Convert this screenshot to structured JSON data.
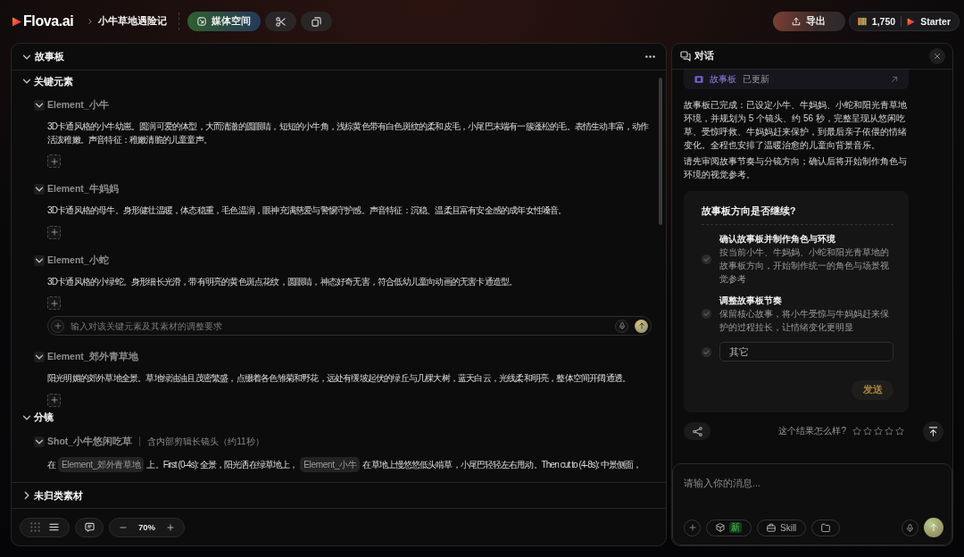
{
  "header": {
    "logo": "Flova.ai",
    "project_title": "小牛草地遇险记",
    "tools": [
      {
        "kind": "media",
        "label": "媒体空间"
      },
      {
        "kind": "scissors"
      },
      {
        "kind": "copy"
      }
    ],
    "export_label": "导出",
    "credits": "1,750",
    "plan": "Starter"
  },
  "storyboard": {
    "title": "故事板",
    "expanded": true,
    "sections": [
      {
        "kind": "elements",
        "title": "关键元素",
        "expanded": true,
        "items": [
          {
            "name": "Element_小牛",
            "expanded": true,
            "description": "3D卡通风格的小牛幼崽。圆润可爱的体型，大而清澈的圆眼睛，短短的小牛角，浅棕黄色带有白色斑纹的柔和皮毛，小尾巴末端有一簇蓬松的毛。表情生动丰富，动作活泼稚嫩。声音特征：稚嫩清脆的儿童童声。"
          },
          {
            "name": "Element_牛妈妈",
            "expanded": true,
            "description": "3D卡通风格的母牛。身形健壮温暖，体态稳重，毛色温润，眼神充满慈爱与警惕守护感。声音特征：沉稳、温柔且富有安全感的成年女性嗓音。"
          },
          {
            "name": "Element_小蛇",
            "expanded": true,
            "description": "3D卡通风格的小绿蛇。身形细长光滑，带有明亮的黄色斑点花纹，圆眼睛，神态好奇无害，符合低幼儿童向动画的无害卡通造型。",
            "input_placeholder": "输入对该关键元素及其素材的调整要求"
          },
          {
            "name": "Element_郊外青草地",
            "expanded": true,
            "description": "阳光明媚的郊外草地全景。草地绿油油且茂密繁盛，点缀着各色雏菊和野花，远处有缓坡起伏的绿丘与几棵大树，蓝天白云，光线柔和明亮，整体空间开阔通透。"
          }
        ]
      },
      {
        "kind": "shots",
        "title": "分镜",
        "expanded": true,
        "items": [
          {
            "name": "Shot_小牛悠闲吃草",
            "note": "含内部剪辑长镜头（约11秒）",
            "expanded": true,
            "script": [
              {
                "kind": "text",
                "text": "在"
              },
              {
                "kind": "tag",
                "text": "Element_郊外青草地"
              },
              {
                "kind": "text",
                "text": "上。First (0-4s): 全景，阳光洒在绿草地上，"
              },
              {
                "kind": "tag",
                "text": "Element_小牛"
              },
              {
                "kind": "text",
                "text": "在草地上慢悠悠低头啃草，小尾巴轻轻左右甩动。Then cut to (4-8s): 中景侧面，"
              }
            ]
          }
        ]
      }
    ],
    "pinned_section": {
      "title": "未归类素材",
      "expanded": false
    },
    "toolbar": {
      "view_modes": [
        {
          "kind": "grid",
          "selected": false
        },
        {
          "kind": "list",
          "selected": true
        }
      ],
      "zoom": "70%"
    }
  },
  "chat": {
    "title": "对话",
    "update_card": {
      "label": "故事板",
      "status": "已更新"
    },
    "messages": [
      "故事板已完成：已设定小牛、牛妈妈、小蛇和阳光青草地环境，并规划为 5 个镜头、约 56 秒，完整呈现从悠闲吃草、受惊呼救、牛妈妈赶来保护，到最后亲子依偎的情绪变化。全程也安排了温暖治愈的儿童向背景音乐。",
      "请先审阅故事节奏与分镜方向；确认后将开始制作角色与环境的视觉参考。"
    ],
    "question": {
      "title": "故事板方向是否继续?",
      "options": [
        {
          "kind": "choice",
          "title": "确认故事板并制作角色与环境",
          "description": "按当前小牛、牛妈妈、小蛇和阳光青草地的故事板方向，开始制作统一的角色与场景视觉参考",
          "selected": false
        },
        {
          "kind": "choice",
          "title": "调整故事板节奏",
          "description": "保留核心故事，将小牛受惊与牛妈妈赶来保护的过程拉长，让情绪变化更明显",
          "selected": false
        },
        {
          "kind": "other",
          "placeholder": "其它",
          "selected": false
        }
      ],
      "submit": "发送"
    },
    "feedback": {
      "prompt": "这个结果怎么样?",
      "stars": 0
    },
    "composer": {
      "placeholder": "请输入你的消息...",
      "tools": [
        {
          "kind": "add"
        },
        {
          "kind": "model",
          "badge": "新"
        },
        {
          "kind": "skill",
          "label": "Skill"
        },
        {
          "kind": "attachment"
        }
      ]
    }
  }
}
